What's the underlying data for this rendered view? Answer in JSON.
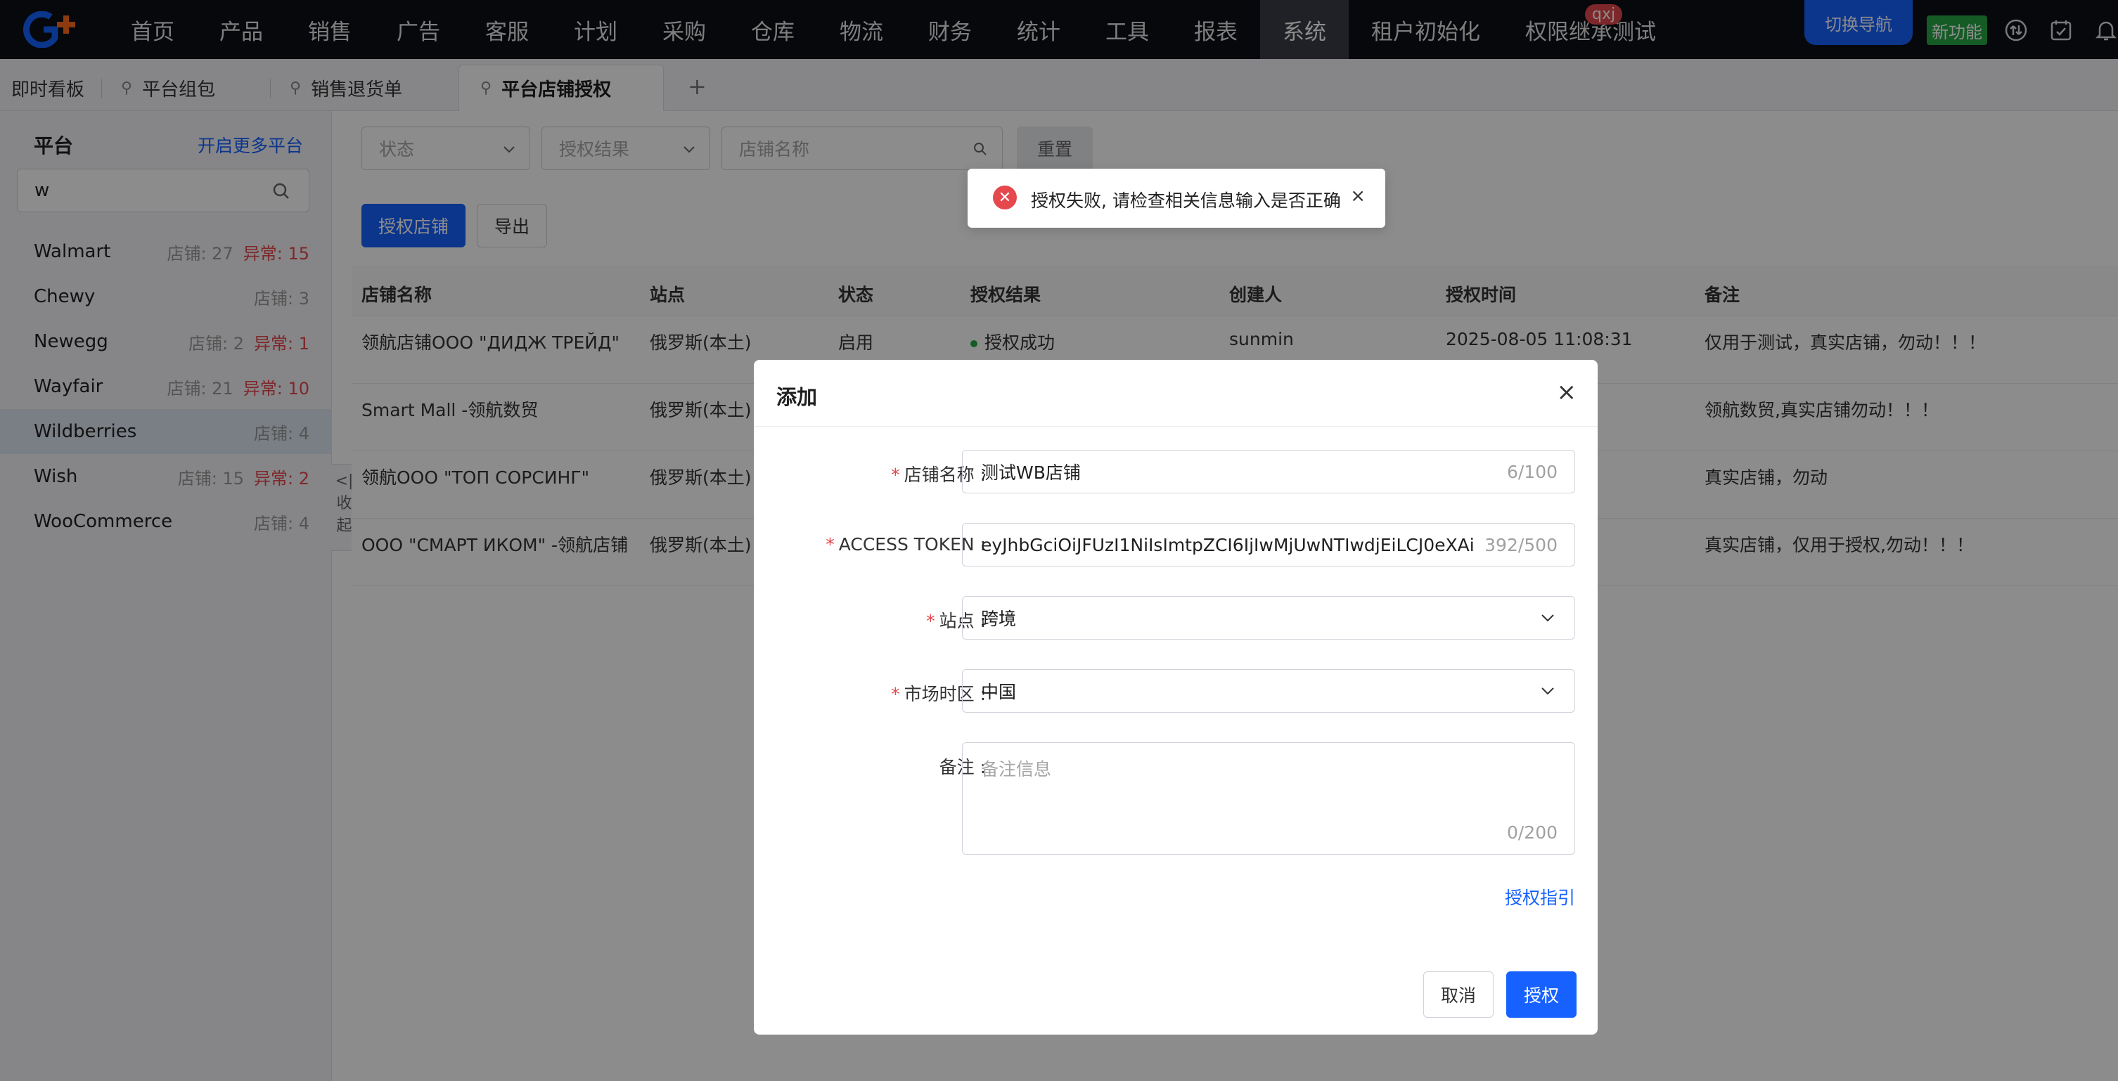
{
  "nav": {
    "items": [
      "首页",
      "产品",
      "销售",
      "广告",
      "客服",
      "计划",
      "采购",
      "仓库",
      "物流",
      "财务",
      "统计",
      "工具",
      "报表",
      "系统",
      "租户初始化",
      "权限继承测试"
    ],
    "active_index": 13,
    "badge": "qxj",
    "switch_label": "切换导航",
    "new_feature_label": "新功能"
  },
  "tabs": {
    "items": [
      {
        "label": "即时看板"
      },
      {
        "label": "平台组包"
      },
      {
        "label": "销售退货单"
      },
      {
        "label": "平台店铺授权"
      }
    ],
    "add_label": "+"
  },
  "sidebar": {
    "title": "平台",
    "more_link": "开启更多平台",
    "search_value": "w",
    "platforms": [
      {
        "name": "Walmart",
        "count": "店铺: 27",
        "abnormal": "异常: 15"
      },
      {
        "name": "Chewy",
        "count": "店铺: 3",
        "abnormal": ""
      },
      {
        "name": "Newegg",
        "count": "店铺: 2",
        "abnormal": "异常: 1"
      },
      {
        "name": "Wayfair",
        "count": "店铺: 21",
        "abnormal": "异常: 10"
      },
      {
        "name": "Wildberries",
        "count": "店铺: 4",
        "abnormal": ""
      },
      {
        "name": "Wish",
        "count": "店铺: 15",
        "abnormal": "异常: 2"
      },
      {
        "name": "WooCommerce",
        "count": "店铺: 4",
        "abnormal": ""
      }
    ],
    "active_index": 4,
    "collapse_label": [
      "<|",
      "收",
      "起"
    ]
  },
  "filters": {
    "status_placeholder": "状态",
    "result_placeholder": "授权结果",
    "store_placeholder": "店铺名称",
    "reset_label": "重置"
  },
  "actions": {
    "authorize_label": "授权店铺",
    "export_label": "导出"
  },
  "table": {
    "columns": [
      "店铺名称",
      "站点",
      "状态",
      "授权结果",
      "创建人",
      "授权时间",
      "备注"
    ],
    "rows": [
      [
        "领航店铺ООО \"ДИДЖ ТРЕЙД\"",
        "俄罗斯(本土)",
        "启用",
        "授权成功",
        "sunmin",
        "2025-08-05 11:08:31",
        "仅用于测试，真实店铺，勿动！！！"
      ],
      [
        "Smart Mall -领航数贸",
        "俄罗斯(本土)",
        "",
        "",
        "",
        "1:31",
        "领航数贸,真实店铺勿动！！！"
      ],
      [
        "领航ООО \"ТОП СОРСИНГ\"",
        "俄罗斯(本土)",
        "",
        "",
        "",
        "5:23",
        "真实店铺，勿动"
      ],
      [
        "ООО \"СМАРТ ИКОМ\" -领航店铺",
        "俄罗斯(本土)",
        "",
        "",
        "",
        "5:42",
        "真实店铺，仅用于授权,勿动！！！"
      ]
    ]
  },
  "toast": {
    "message": "授权失败, 请检查相关信息输入是否正确",
    "close": "×",
    "icon": "error-icon"
  },
  "dialog": {
    "title": "添加",
    "close": "×",
    "fields": {
      "store_name": {
        "label": "店铺名称",
        "value": "测试WB店铺",
        "count": "6/100"
      },
      "token": {
        "label": "ACCESS TOKEN",
        "value": "eyJhbGciOiJFUzI1NiIsImtpZCI6IjIwMjUwNTIwdjEiLCJ0eXAi",
        "count": "392/500"
      },
      "site": {
        "label": "站点",
        "value": "跨境"
      },
      "timezone": {
        "label": "市场时区",
        "value": "中国"
      },
      "remark": {
        "label": "备注",
        "placeholder": "备注信息",
        "count": "0/200"
      }
    },
    "guide_link": "授权指引",
    "cancel_label": "取消",
    "submit_label": "授权"
  },
  "colors": {
    "primary": "#1661ff",
    "danger": "#e5484d",
    "success": "#27a745",
    "nav_bg": "#0b0f17"
  }
}
